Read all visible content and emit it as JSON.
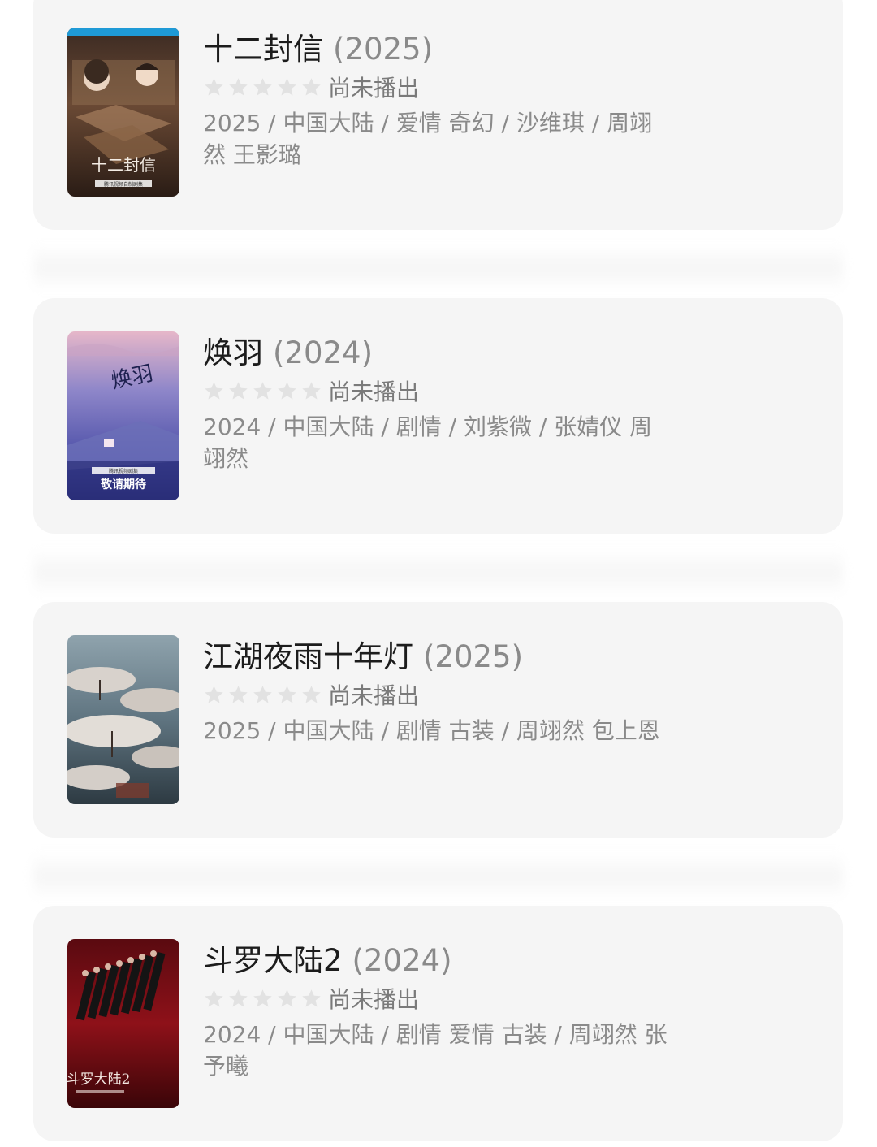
{
  "shows": [
    {
      "title": "十二封信",
      "year": "(2025)",
      "rating_status": "尚未播出",
      "meta": "2025 / 中国大陆 / 爱情 奇幻 / 沙维琪 / 周翊然 王影璐",
      "poster": {
        "text": "十二封信",
        "badge": "腾讯视频自制剧集"
      }
    },
    {
      "title": "焕羽",
      "year": "(2024)",
      "rating_status": "尚未播出",
      "meta": "2024 / 中国大陆 / 剧情 / 刘紫微 / 张婧仪 周翊然",
      "poster": {
        "text": "焕羽",
        "badge": "腾讯视频剧集",
        "caption": "敬请期待"
      }
    },
    {
      "title": "江湖夜雨十年灯",
      "year": "(2025)",
      "rating_status": "尚未播出",
      "meta": "2025 / 中国大陆 / 剧情 古装 / 周翊然 包上恩",
      "poster": {
        "text": ""
      }
    },
    {
      "title": "斗罗大陆2",
      "year": "(2024)",
      "rating_status": "尚未播出",
      "meta": "2024 / 中国大陆 / 剧情 爱情 古装 / 周翊然 张予曦",
      "poster": {
        "text": "斗罗大陆2"
      }
    }
  ],
  "colors": {
    "card_bg": "#f5f5f5",
    "title": "#1c1c1c",
    "muted": "#8a8a8a",
    "star_empty": "#e2e2e2"
  }
}
